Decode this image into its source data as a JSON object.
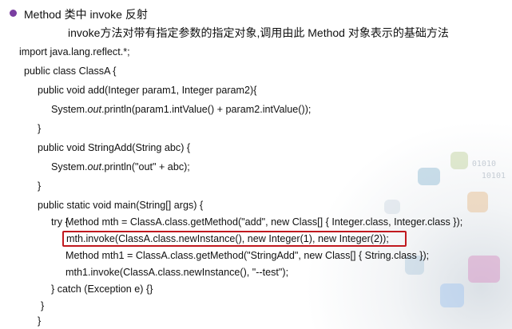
{
  "header": {
    "title": "Method 类中 invoke 反射",
    "subtitle": "invoke方法对带有指定参数的指定对象,调用由此 Method 对象表示的基础方法"
  },
  "code": {
    "line1": "import java.lang.reflect.*;",
    "line2": "public class ClassA {",
    "line3": "public void add(Integer param1, Integer param2){",
    "line4_pre": "System.",
    "line4_italic": "out",
    "line4_post": ".println(param1.intValue() + param2.intValue());",
    "line5": "}",
    "line6": "public void StringAdd(String abc) {",
    "line7_pre": "System.",
    "line7_italic": "out",
    "line7_post": ".println(\"out\" + abc);",
    "line8": "}",
    "line9": "public static void main(String[] args) {",
    "line10": "try {",
    "line11": "Method mth = ClassA.class.getMethod(\"add\", new Class[] { Integer.class, Integer.class });",
    "line12": "mth.invoke(ClassA.class.newInstance(), new Integer(1), new Integer(2));",
    "line13": "Method mth1 = ClassA.class.getMethod(\"StringAdd\", new Class[] { String.class });",
    "line14": "mth1.invoke(ClassA.class.newInstance(), \"--test\");",
    "line15": "} catch (Exception e) {}",
    "line16": "}",
    "line17": "}"
  },
  "decoration": {
    "binary_text_1": "01010",
    "binary_text_2": "10101"
  },
  "colors": {
    "bullet": "#7a3ea1",
    "highlight_border": "#c0191f",
    "text": "#111111"
  }
}
